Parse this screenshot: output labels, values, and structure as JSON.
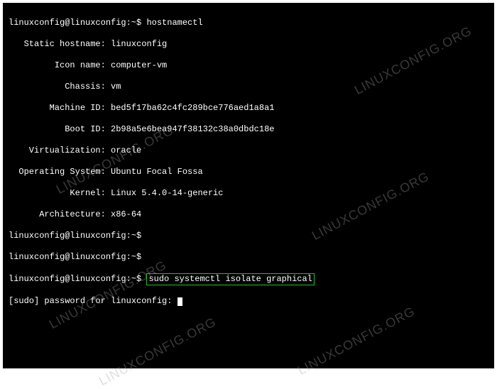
{
  "terminal": {
    "prompt": "linuxconfig@linuxconfig:~$",
    "command1": "hostnamectl",
    "output": {
      "static_hostname_label": "   Static hostname:",
      "static_hostname_value": "linuxconfig",
      "icon_name_label": "         Icon name:",
      "icon_name_value": "computer-vm",
      "chassis_label": "           Chassis:",
      "chassis_value": "vm",
      "machine_id_label": "        Machine ID:",
      "machine_id_value": "bed5f17ba62c4fc289bce776aed1a8a1",
      "boot_id_label": "           Boot ID:",
      "boot_id_value": "2b98a5e6bea947f38132c38a0dbdc18e",
      "virtualization_label": "    Virtualization:",
      "virtualization_value": "oracle",
      "operating_system_label": "  Operating System:",
      "operating_system_value": "Ubuntu Focal Fossa",
      "kernel_label": "            Kernel:",
      "kernel_value": "Linux 5.4.0-14-generic",
      "architecture_label": "      Architecture:",
      "architecture_value": "x86-64"
    },
    "highlighted_command": "sudo systemctl isolate graphical",
    "sudo_prompt": "[sudo] password for linuxconfig:"
  },
  "watermark": "LINUXCONFIG.ORG"
}
